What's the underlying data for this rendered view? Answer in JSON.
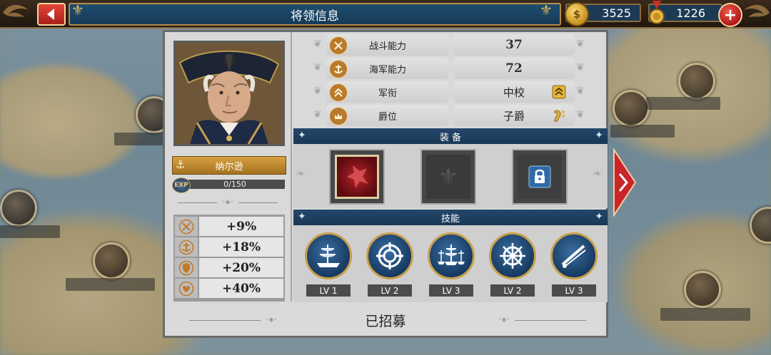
{
  "header": {
    "title": "将领信息",
    "gold": "3525",
    "medals": "1226"
  },
  "general": {
    "name": "纳尔逊",
    "exp_label": "EXP",
    "exp": "0/150",
    "exp_fraction": 0.0,
    "bonuses": [
      {
        "icon": "crossed-swords-icon",
        "value": "+9%"
      },
      {
        "icon": "anchor-icon",
        "value": "+18%"
      },
      {
        "icon": "shield-icon",
        "value": "+20%"
      },
      {
        "icon": "heart-icon",
        "value": "+40%"
      }
    ]
  },
  "stats": [
    {
      "icon": "crossed-swords-icon",
      "label": "战斗能力",
      "value": "37"
    },
    {
      "icon": "anchor-icon",
      "label": "海军能力",
      "value": "72"
    },
    {
      "icon": "rank-icon",
      "label": "军衔",
      "value": "中校"
    },
    {
      "icon": "nobility-icon",
      "label": "爵位",
      "value": "子爵"
    }
  ],
  "equipment": {
    "title": "装 备",
    "slots": [
      {
        "state": "equipped",
        "icon": "red-item-icon"
      },
      {
        "state": "empty",
        "icon": "fleur-de-lis-icon"
      },
      {
        "state": "locked",
        "icon": "lock-icon"
      }
    ]
  },
  "skills": {
    "title": "技能",
    "items": [
      {
        "icon": "ship-icon",
        "level": "LV 1"
      },
      {
        "icon": "crosshair-icon",
        "level": "LV 2"
      },
      {
        "icon": "fleet-icon",
        "level": "LV 3"
      },
      {
        "icon": "ship-wheel-icon",
        "level": "LV 2"
      },
      {
        "icon": "cannon-icon",
        "level": "LV 3"
      }
    ]
  },
  "footer": {
    "status": "已招募"
  },
  "colors": {
    "accent_gold": "#c9a04a",
    "header_blue": "#1a3856",
    "button_red": "#c0231c"
  }
}
